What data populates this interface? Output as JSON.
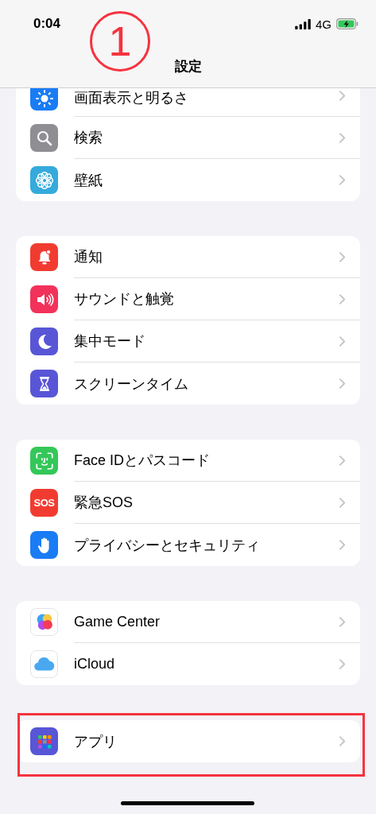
{
  "status_bar": {
    "time": "0:04",
    "network": "4G"
  },
  "annotation_number": "1",
  "title": "設定",
  "groups": [
    {
      "highlighted": false,
      "items": [
        {
          "kind": "brightness",
          "label": "画面表示と明るさ",
          "color": "#1a7cf5"
        },
        {
          "kind": "search",
          "label": "検索",
          "color": "#8e8e93"
        },
        {
          "kind": "wallpaper",
          "label": "壁紙",
          "color": "#35aadc"
        }
      ]
    },
    {
      "highlighted": false,
      "items": [
        {
          "kind": "bell",
          "label": "通知",
          "color": "#f23b30"
        },
        {
          "kind": "speaker",
          "label": "サウンドと触覚",
          "color": "#f2325a"
        },
        {
          "kind": "moon",
          "label": "集中モード",
          "color": "#5856d6"
        },
        {
          "kind": "hourglass",
          "label": "スクリーンタイム",
          "color": "#5856d6"
        }
      ]
    },
    {
      "highlighted": false,
      "items": [
        {
          "kind": "faceid",
          "label": "Face IDとパスコード",
          "color": "#34c759"
        },
        {
          "kind": "sos",
          "label": "緊急SOS",
          "color": "#f23b30",
          "icon_text": "SOS"
        },
        {
          "kind": "hand",
          "label": "プライバシーとセキュリティ",
          "color": "#1a7cf5"
        }
      ]
    },
    {
      "highlighted": false,
      "items": [
        {
          "kind": "gamecenter",
          "label": "Game Center",
          "color": "#ffffff"
        },
        {
          "kind": "icloud",
          "label": "iCloud",
          "color": "#ffffff"
        }
      ]
    },
    {
      "highlighted": true,
      "items": [
        {
          "kind": "apps",
          "label": "アプリ",
          "color": "#5856d6"
        }
      ]
    }
  ]
}
